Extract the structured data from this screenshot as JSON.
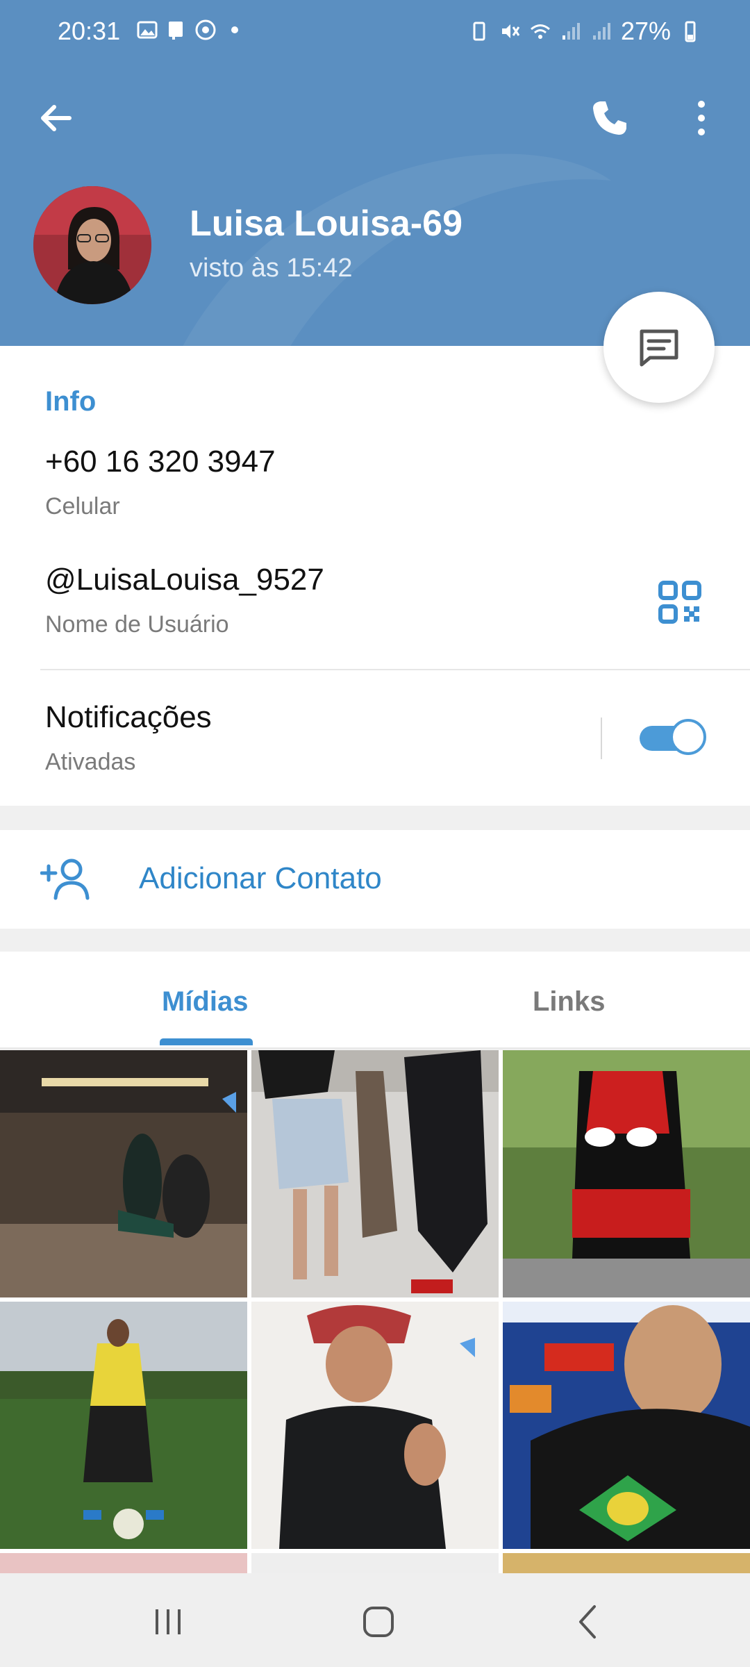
{
  "status_bar": {
    "time": "20:31",
    "battery": "27%"
  },
  "header": {
    "contact_name": "Luisa Louisa-69",
    "last_seen": "visto às 15:42",
    "colors": {
      "header_bg": "#5b8fc1",
      "accent": "#3d8fd1"
    }
  },
  "info": {
    "section_title": "Info",
    "phone": "+60 16 320 3947",
    "phone_label": "Celular",
    "username": "@LuisaLouisa_9527",
    "username_label": "Nome de Usuário",
    "notifications_title": "Notificações",
    "notifications_state": "Ativadas",
    "notifications_enabled": true
  },
  "actions": {
    "add_contact": "Adicionar Contato"
  },
  "tabs": [
    {
      "label": "Mídias",
      "active": true
    },
    {
      "label": "Links",
      "active": false
    }
  ],
  "media": [
    {
      "name": "media-thumb-1",
      "colors": [
        "#5a4a3c",
        "#2b2420",
        "#9a8572"
      ]
    },
    {
      "name": "media-thumb-2",
      "colors": [
        "#dedcd8",
        "#1e1e22",
        "#9aa8b8"
      ]
    },
    {
      "name": "media-thumb-3",
      "colors": [
        "#6b8a4a",
        "#121212",
        "#c62020"
      ]
    },
    {
      "name": "media-thumb-4",
      "colors": [
        "#b9c2c8",
        "#3d5f2c",
        "#e9d53c"
      ]
    },
    {
      "name": "media-thumb-5",
      "colors": [
        "#f2f0ed",
        "#1b1c1e",
        "#b43a3a"
      ]
    },
    {
      "name": "media-thumb-6",
      "colors": [
        "#1d3f8c",
        "#151515",
        "#c6a27a"
      ]
    }
  ],
  "icons": {
    "back": "arrow-left-icon",
    "call": "phone-icon",
    "more": "more-vertical-icon",
    "message": "message-icon",
    "qr": "qr-code-icon",
    "add_contact": "add-person-icon"
  }
}
